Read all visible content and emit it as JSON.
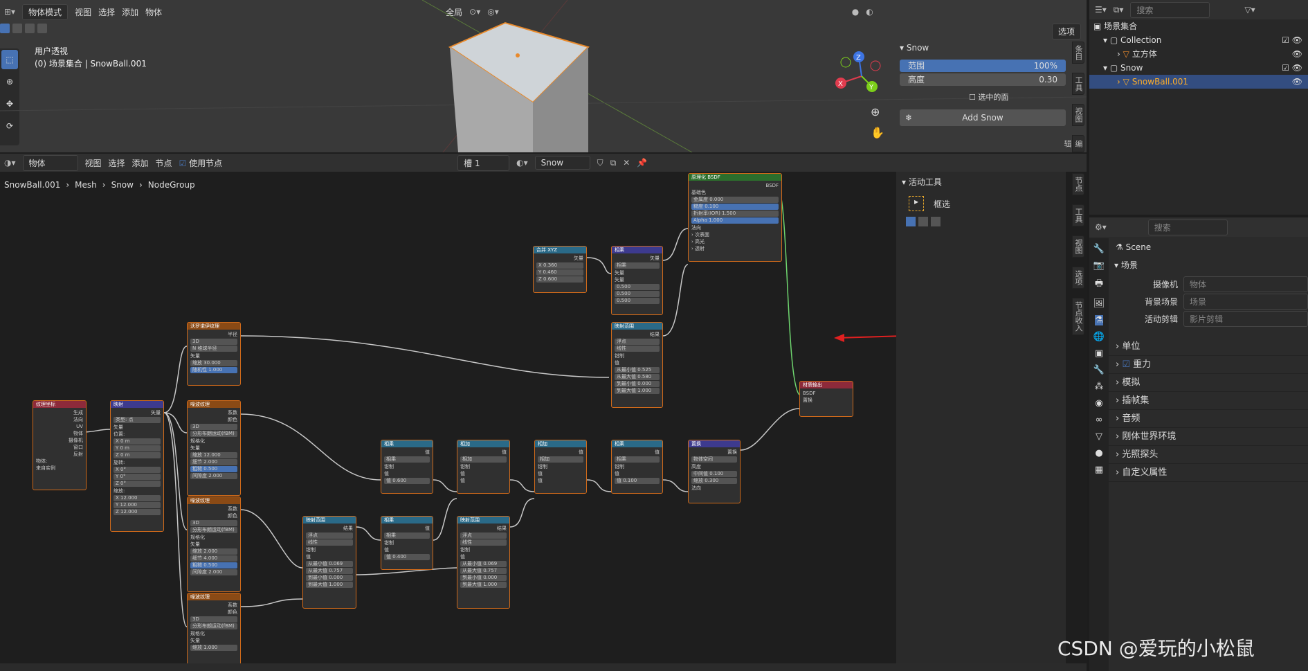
{
  "viewport": {
    "mode": "物体模式",
    "menu": [
      "视图",
      "选择",
      "添加",
      "物体"
    ],
    "transform": "全局",
    "view_name": "用户透视",
    "collection_path": "(0) 场景集合 | SnowBall.001",
    "options": "选项"
  },
  "snow_panel": {
    "title": "Snow",
    "range_label": "范围",
    "range_value": "100%",
    "height_label": "高度",
    "height_value": "0.30",
    "selected_faces": "选中的面",
    "add_button": "Add Snow"
  },
  "viewport_tabs": [
    "条目",
    "工具",
    "视图",
    "编辑"
  ],
  "node_editor": {
    "mode": "物体",
    "menu": [
      "视图",
      "选择",
      "添加",
      "节点"
    ],
    "use_nodes": "使用节点",
    "slot": "槽 1",
    "material": "Snow",
    "breadcrumb": [
      "SnowBall.001",
      "Mesh",
      "Snow",
      "NodeGroup"
    ]
  },
  "active_tool": {
    "title": "活动工具",
    "tool": "框选"
  },
  "node_tabs": [
    "节点",
    "工具",
    "视图",
    "选项",
    "节点收入"
  ],
  "outliner": {
    "search_placeholder": "搜索",
    "root": "场景集合",
    "items": [
      {
        "label": "Collection"
      },
      {
        "label": "立方体"
      },
      {
        "label": "Snow"
      },
      {
        "label": "SnowBall.001"
      }
    ]
  },
  "properties": {
    "search_placeholder": "搜索",
    "scene_name": "Scene",
    "section": "场景",
    "fields": [
      {
        "label": "摄像机",
        "value": "物体"
      },
      {
        "label": "背景场景",
        "value": "场景"
      },
      {
        "label": "活动剪辑",
        "value": "影片剪辑"
      }
    ],
    "sections": [
      "单位",
      "重力",
      "模拟",
      "插帧集",
      "音频",
      "刚体世界环境",
      "光照探头",
      "自定义属性"
    ]
  },
  "nodes": {
    "bsdf": {
      "title": "原理化 BSDF",
      "out": "BSDF",
      "rows": [
        "基础色",
        "金属度 0.000",
        "糙度 0.100",
        "折射率(IOR) 1.500",
        "Alpha 1.000",
        "法向",
        "› 次表面",
        "› 高光",
        "› 透射",
        "› 涂层",
        "› 边缘光泽",
        "› 自发光",
        "› 薄膜"
      ]
    },
    "combine": {
      "title": "合并 XYZ",
      "out": "矢量",
      "rows": [
        "X 0.360",
        "Y 0.460",
        "Z 0.600"
      ]
    },
    "mix1": {
      "title": "相乘",
      "out": "矢量",
      "rows": [
        "相乘",
        "矢量",
        "矢量",
        "0.500",
        "0.500",
        "0.500"
      ]
    },
    "maprange1": {
      "title": "映射范围",
      "out": "结果",
      "rows": [
        "浮点",
        "线性",
        "钳制",
        "值",
        "从最小值 0.525",
        "从最大值 0.580",
        "到最小值 0.000",
        "到最大值 1.000"
      ]
    },
    "voronoi": {
      "title": "沃罗诺伊纹理",
      "out": "半径",
      "rows": [
        "3D",
        "N 维球半径",
        "矢量",
        "缩放 30.000",
        "随机性 1.000"
      ]
    },
    "texcoord": {
      "title": "纹理坐标",
      "rows": [
        "生成",
        "法向",
        "UV",
        "物体",
        "摄像机",
        "窗口",
        "反射",
        "物体:",
        "来自实例"
      ]
    },
    "mapping": {
      "title": "映射",
      "out": "矢量",
      "rows": [
        "类型: 点",
        "矢量",
        "位置:",
        "X 0 m",
        "Y 0 m",
        "Z 0 m",
        "旋转:",
        "X 0°",
        "Y 0°",
        "Z 0°",
        "缩放:",
        "X 12.000",
        "Y 12.000",
        "Z 12.000"
      ]
    },
    "noise1": {
      "title": "噪波纹理",
      "rows": [
        "系数",
        "颜色",
        "3D",
        "分形布朗运动(fBM)",
        "规格化",
        "矢量",
        "缩放 12.000",
        "细节 2.000",
        "粗糙 0.500",
        "间隙度 2.000"
      ]
    },
    "noise2": {
      "title": "噪波纹理",
      "rows": [
        "系数",
        "颜色",
        "3D",
        "分形布朗运动(fBM)",
        "规格化",
        "矢量",
        "缩放 2.000",
        "细节 4.000",
        "粗糙 0.500",
        "间隙度 2.000"
      ]
    },
    "noise3": {
      "title": "噪波纹理",
      "rows": [
        "系数",
        "颜色",
        "3D",
        "分形布朗运动(fBM)",
        "规格化",
        "矢量",
        "缩放 1.000"
      ]
    },
    "math1": {
      "title": "相乘",
      "out": "值",
      "rows": [
        "相乘",
        "钳制",
        "值",
        "值 0.600"
      ]
    },
    "math2": {
      "title": "相加",
      "out": "值",
      "rows": [
        "相加",
        "钳制",
        "值",
        "值"
      ]
    },
    "math3": {
      "title": "相加",
      "out": "值",
      "rows": [
        "相加",
        "钳制",
        "值",
        "值"
      ]
    },
    "math4": {
      "title": "相乘",
      "out": "值",
      "rows": [
        "相乘",
        "钳制",
        "值",
        "值 0.100"
      ]
    },
    "math5": {
      "title": "相乘",
      "out": "值",
      "rows": [
        "相乘",
        "钳制",
        "值",
        "值 0.400"
      ]
    },
    "maprange2": {
      "title": "映射范围",
      "out": "结果",
      "rows": [
        "浮点",
        "线性",
        "钳制",
        "值",
        "从最小值 0.069",
        "从最大值 0.757",
        "到最小值 0.000",
        "到最大值 1.000"
      ]
    },
    "maprange3": {
      "title": "映射范围",
      "out": "结果",
      "rows": [
        "浮点",
        "线性",
        "钳制",
        "值",
        "从最小值 0.069",
        "从最大值 0.757",
        "到最小值 0.000",
        "到最大值 1.000"
      ]
    },
    "displace": {
      "title": "置换",
      "out": "置换",
      "rows": [
        "物体空间",
        "高度",
        "中间值 0.100",
        "缩放 0.300",
        "法向"
      ]
    },
    "output": {
      "title": "材质输出",
      "rows": [
        "BSDF",
        "置换"
      ]
    }
  },
  "watermark": "CSDN @爱玩的小松鼠"
}
